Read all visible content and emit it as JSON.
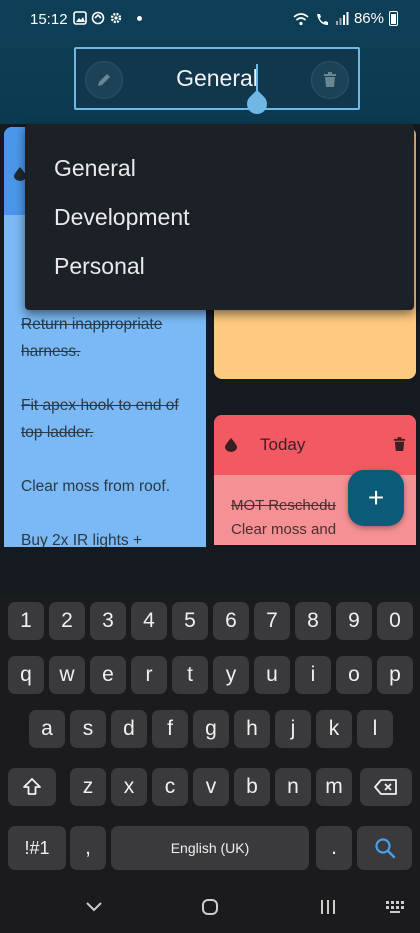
{
  "status_bar": {
    "time": "15:12",
    "battery": "86%",
    "left_icons": [
      "gallery-icon",
      "sync-icon",
      "gear-icon"
    ],
    "right_icons": [
      "wifi-icon",
      "wifi-call-icon",
      "signal-icon",
      "battery-icon"
    ]
  },
  "editor": {
    "title_value": "General",
    "left_icon": "pencil-icon",
    "right_icon": "trash-icon"
  },
  "dropdown": {
    "options": [
      "General",
      "Development",
      "Personal"
    ]
  },
  "notes": {
    "blue_card": {
      "lines": [
        {
          "text": "Return inappropriate harness.",
          "struck": true
        },
        {
          "text": "Fit apex hook to end of top ladder.",
          "struck": true
        },
        {
          "text": "Clear moss from roof.",
          "struck": false
        },
        {
          "text": "Buy 2x IR lights +",
          "struck": false
        }
      ]
    },
    "red_card": {
      "title": "Today",
      "line1": "MOT Reschedu",
      "line2": "Clear moss and"
    }
  },
  "fab": {
    "label": "+"
  },
  "keyboard": {
    "row1": [
      "1",
      "2",
      "3",
      "4",
      "5",
      "6",
      "7",
      "8",
      "9",
      "0"
    ],
    "row2": [
      "q",
      "w",
      "e",
      "r",
      "t",
      "y",
      "u",
      "i",
      "o",
      "p"
    ],
    "row3": [
      "a",
      "s",
      "d",
      "f",
      "g",
      "h",
      "j",
      "k",
      "l"
    ],
    "row4": [
      "z",
      "x",
      "c",
      "v",
      "b",
      "n",
      "m"
    ],
    "symbols": "!#1",
    "comma": ",",
    "space": "English (UK)",
    "period": "."
  },
  "colors": {
    "accent": "#6fb8e6",
    "blue_card": "#7ab9f5",
    "orange_card": "#fdca80",
    "red_card": "#f59194",
    "fab": "#0b5a77"
  }
}
